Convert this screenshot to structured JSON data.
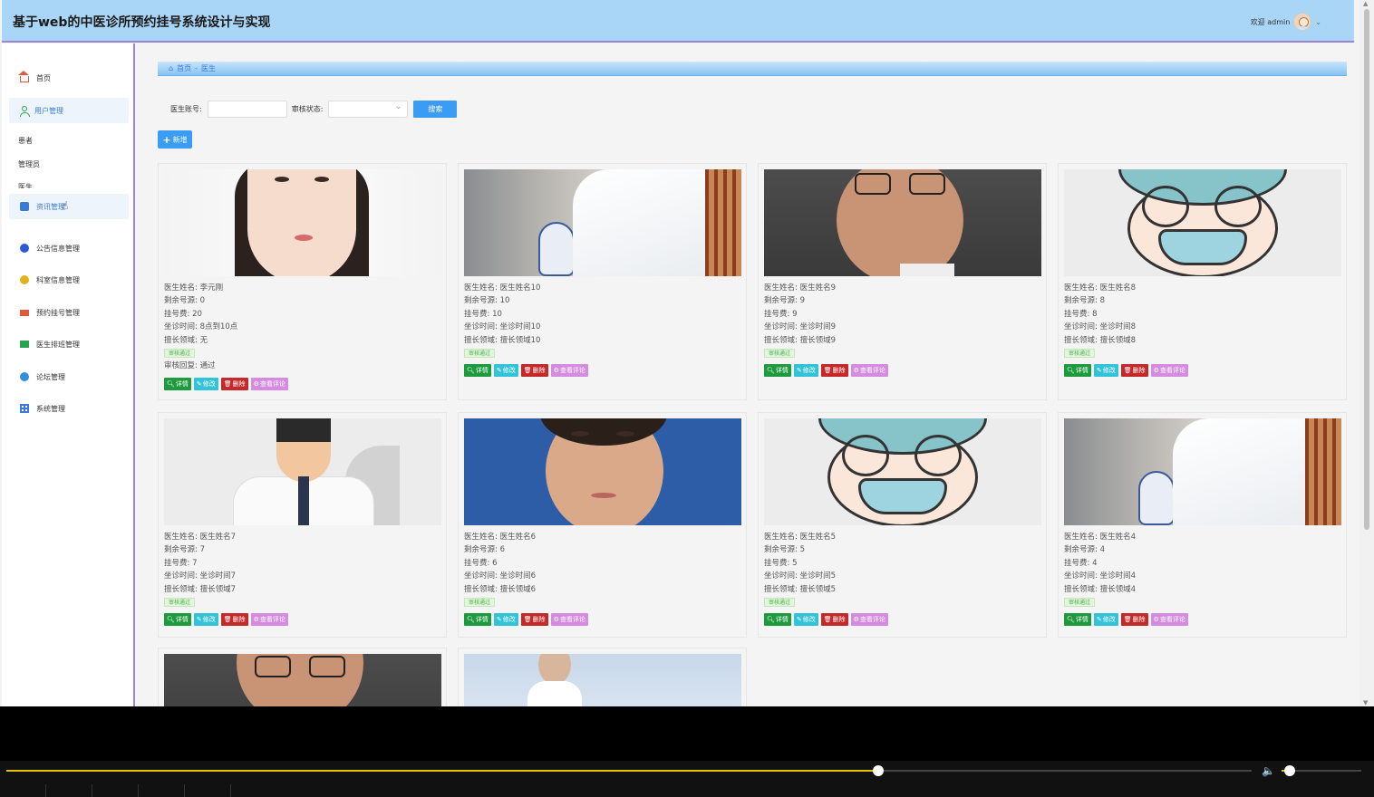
{
  "header": {
    "title": "基于web的中医诊所预约挂号系统设计与实现",
    "welcome": "欢迎 admin"
  },
  "sidebar": {
    "items": [
      {
        "label": "首页",
        "icon": "home-icon"
      },
      {
        "label": "用户管理",
        "icon": "user-icon"
      },
      {
        "label": "资讯管理",
        "icon": "news-icon"
      },
      {
        "label": "公告信息管理",
        "icon": "notice-icon"
      },
      {
        "label": "科室信息管理",
        "icon": "department-icon"
      },
      {
        "label": "预约挂号管理",
        "icon": "appointment-icon"
      },
      {
        "label": "医生排班管理",
        "icon": "schedule-icon"
      },
      {
        "label": "论坛管理",
        "icon": "forum-icon"
      },
      {
        "label": "系统管理",
        "icon": "settings-grid-icon"
      }
    ],
    "sub_items": [
      "患者",
      "管理员",
      "医生"
    ]
  },
  "breadcrumb": {
    "home": "首页",
    "sep": "-",
    "current": "医生"
  },
  "search": {
    "account_label": "医生账号:",
    "account_value": "",
    "status_label": "审核状态:",
    "status_value": "",
    "search_button": "搜索",
    "add_button": "新增"
  },
  "labels": {
    "name": "医生姓名:",
    "remaining": "剩余号源:",
    "fee": "挂号费:",
    "time": "坐诊时间:",
    "field": "擅长领域:",
    "reply": "审核回复:",
    "detail": "详情",
    "edit": "修改",
    "delete": "删除",
    "comments": "查看评论"
  },
  "doctors": [
    {
      "name": "李元刚",
      "remaining": "0",
      "fee": "20",
      "time": "8点到10点",
      "field": "无",
      "status": "审核通过",
      "reply": "通过",
      "photo": "woman"
    },
    {
      "name": "医生姓名10",
      "remaining": "10",
      "fee": "10",
      "time": "坐诊时间10",
      "field": "擅长领域10",
      "status": "审核通过",
      "photo": "clinic"
    },
    {
      "name": "医生姓名9",
      "remaining": "9",
      "fee": "9",
      "time": "坐诊时间9",
      "field": "擅长领域9",
      "status": "审核通过",
      "photo": "man"
    },
    {
      "name": "医生姓名8",
      "remaining": "8",
      "fee": "8",
      "time": "坐诊时间8",
      "field": "擅长领域8",
      "status": "审核通过",
      "photo": "cartoon"
    },
    {
      "name": "医生姓名7",
      "remaining": "7",
      "fee": "7",
      "time": "坐诊时间7",
      "field": "擅长领域7",
      "status": "审核通过",
      "photo": "flatdoc"
    },
    {
      "name": "医生姓名6",
      "remaining": "6",
      "fee": "6",
      "time": "坐诊时间6",
      "field": "擅长领域6",
      "status": "审核通过",
      "photo": "woman2"
    },
    {
      "name": "医生姓名5",
      "remaining": "5",
      "fee": "5",
      "time": "坐诊时间5",
      "field": "擅长领域5",
      "status": "审核通过",
      "photo": "cartoon"
    },
    {
      "name": "医生姓名4",
      "remaining": "4",
      "fee": "4",
      "time": "坐诊时间4",
      "field": "擅长领域4",
      "status": "审核通过",
      "photo": "clinic"
    }
  ],
  "player": {
    "progress": 0.7,
    "volume": 0.1
  },
  "colors": {
    "header_bg": "#a9d5f7",
    "accent": "#3b9cf3",
    "detail": "#1d9a3d",
    "edit": "#33c3d8",
    "delete": "#c42828",
    "comments": "#d58ce0"
  }
}
